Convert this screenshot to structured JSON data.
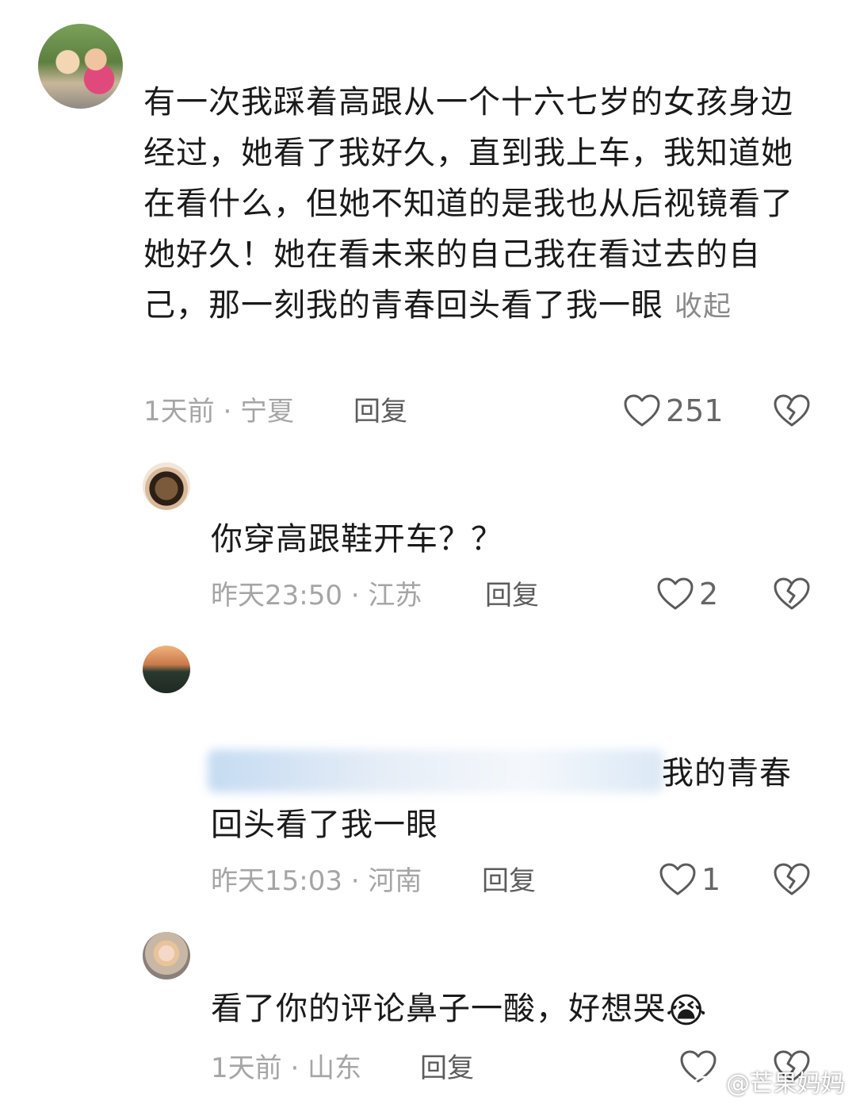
{
  "main_comment": {
    "text": "有一次我踩着高跟从一个十六七岁的女孩身边经过，她看了我好久，直到我上车，我知道她在看什么，但她不知道的是我也从后视镜看了她好久！她在看未来的自己我在看过去的自己，那一刻我的青春回头看了我一眼",
    "collapse_label": "收起",
    "meta": "1天前 · 宁夏",
    "reply_label": "回复",
    "likes": "251"
  },
  "replies": [
    {
      "text": "你穿高跟鞋开车？？",
      "meta": "昨天23:50 · 江苏",
      "reply_label": "回复",
      "likes": "2"
    },
    {
      "text_line1": "我的青春",
      "text_line2": "回头看了我一眼",
      "meta": "昨天15:03 · 河南",
      "reply_label": "回复",
      "likes": "1"
    },
    {
      "text": "看了你的评论鼻子一酸，好想哭",
      "emoji": "😭",
      "meta": "1天前 · 山东",
      "reply_label": "回复",
      "likes": ""
    }
  ],
  "watermark": "@芒果妈妈",
  "colors": {
    "text": "#1a1a1a",
    "meta": "#a5a5a5",
    "reply": "#5c5c5c",
    "icon_stroke": "#5a5a5a"
  },
  "icons": [
    "heart-icon",
    "broken-heart-icon",
    "weibo-logo-icon"
  ]
}
